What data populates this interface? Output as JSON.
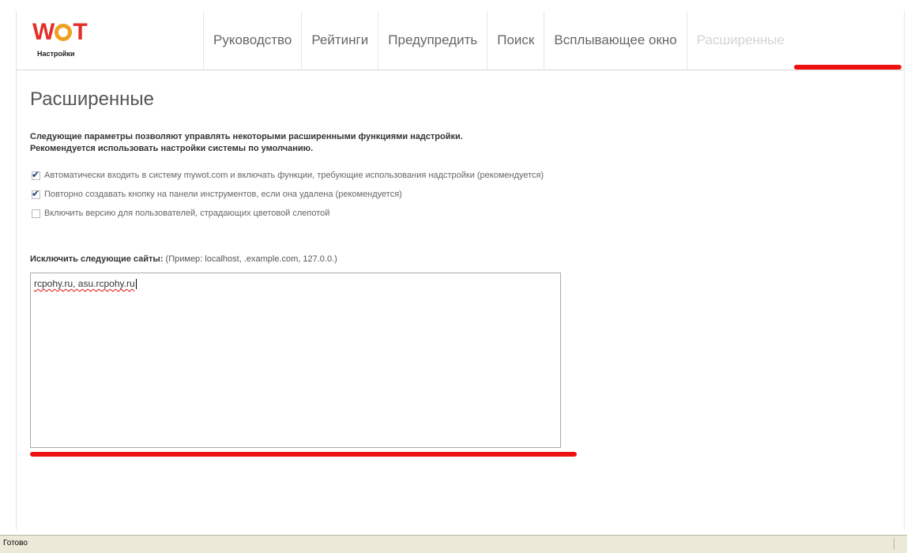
{
  "header": {
    "logo": {
      "letters": "WOT",
      "subtitle": "Настройки"
    },
    "tabs": [
      {
        "label": "Руководство",
        "active": false
      },
      {
        "label": "Рейтинги",
        "active": false
      },
      {
        "label": "Предупредить",
        "active": false
      },
      {
        "label": "Поиск",
        "active": false
      },
      {
        "label": "Всплывающее окно",
        "active": false
      },
      {
        "label": "Расширенные",
        "active": true
      }
    ]
  },
  "main": {
    "title": "Расширенные",
    "description_line1": "Следующие параметры позволяют управлять некоторыми расширенными функциями надстройки.",
    "description_line2": "Рекомендуется использовать настройки системы по умолчанию.",
    "options": [
      {
        "label": "Автоматически входить в систему mywot.com и включать функции, требующие использования надстройки (рекомендуется)",
        "checked": true
      },
      {
        "label": "Повторно создавать кнопку на панели инструментов, если она удалена (рекомендуется)",
        "checked": true
      },
      {
        "label": "Включить версию для пользователей, страдающих цветовой слепотой",
        "checked": false
      }
    ],
    "exclude": {
      "label_bold": "Исключить следующие сайты:",
      "label_hint": "(Пример: localhost, .example.com, 127.0.0.)",
      "value": "rcpohy.ru, asu.rcpohy.ru"
    }
  },
  "statusbar": {
    "text": "Готово"
  },
  "colors": {
    "highlight_underline": "#ee1111",
    "logo_red": "#e0302a",
    "logo_orange": "#f0a020",
    "statusbar_bg": "#ece9d8"
  }
}
